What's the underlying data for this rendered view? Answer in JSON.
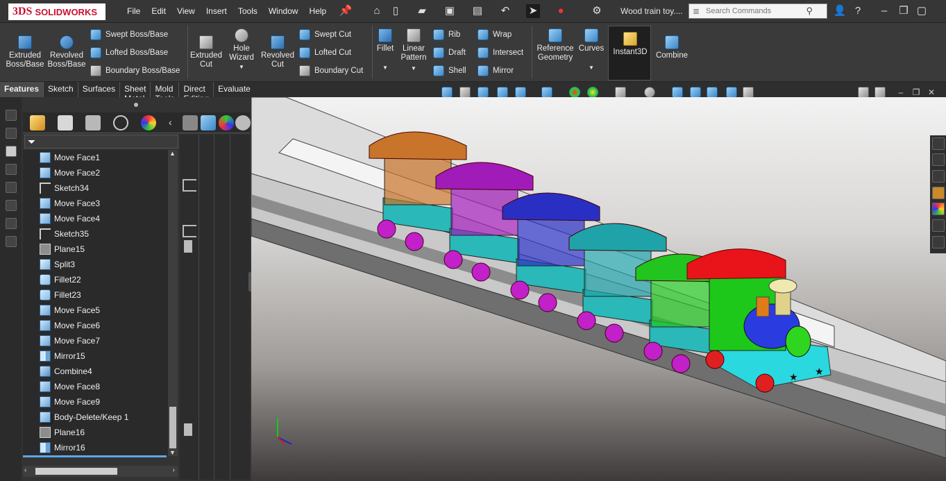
{
  "app": {
    "brand_mark": "3DS",
    "brand_name": "SOLIDWORKS",
    "document_title": "Wood train toy....",
    "menus": [
      "File",
      "Edit",
      "View",
      "Insert",
      "Tools",
      "Window",
      "Help"
    ],
    "search": {
      "placeholder": "Search Commands"
    }
  },
  "ribbon": {
    "buttons": {
      "extruded_boss": "Extruded\nBoss/Base",
      "revolved_boss": "Revolved\nBoss/Base",
      "swept_boss": "Swept Boss/Base",
      "lofted_boss": "Lofted Boss/Base",
      "boundary_boss": "Boundary Boss/Base",
      "extruded_cut": "Extruded\nCut",
      "hole_wizard": "Hole\nWizard",
      "revolved_cut": "Revolved\nCut",
      "swept_cut": "Swept Cut",
      "lofted_cut": "Lofted Cut",
      "boundary_cut": "Boundary Cut",
      "fillet": "Fillet",
      "linear_pattern": "Linear\nPattern",
      "rib": "Rib",
      "draft": "Draft",
      "shell": "Shell",
      "wrap": "Wrap",
      "intersect": "Intersect",
      "mirror": "Mirror",
      "reference_geometry": "Reference\nGeometry",
      "curves": "Curves",
      "instant3d": "Instant3D",
      "combine": "Combine"
    }
  },
  "tabs": [
    "Features",
    "Sketch",
    "Surfaces",
    "Sheet Metal",
    "Mold Tools",
    "Direct Editing",
    "Evaluate"
  ],
  "active_tab": "Features",
  "feature_tree": [
    {
      "label": "Move Face1",
      "icon": "move-face-icon"
    },
    {
      "label": "Move Face2",
      "icon": "move-face-icon"
    },
    {
      "label": "Sketch34",
      "icon": "sketch-icon"
    },
    {
      "label": "Move Face3",
      "icon": "move-face-icon"
    },
    {
      "label": "Move Face4",
      "icon": "move-face-icon"
    },
    {
      "label": "Sketch35",
      "icon": "sketch-icon"
    },
    {
      "label": "Plane15",
      "icon": "plane-icon"
    },
    {
      "label": "Split3",
      "icon": "split-icon"
    },
    {
      "label": "Fillet22",
      "icon": "fillet-icon"
    },
    {
      "label": "Fillet23",
      "icon": "fillet-icon"
    },
    {
      "label": "Move Face5",
      "icon": "move-face-icon"
    },
    {
      "label": "Move Face6",
      "icon": "move-face-icon"
    },
    {
      "label": "Move Face7",
      "icon": "move-face-icon"
    },
    {
      "label": "Mirror15",
      "icon": "mirror-icon"
    },
    {
      "label": "Combine4",
      "icon": "combine-icon"
    },
    {
      "label": "Move Face8",
      "icon": "move-face-icon"
    },
    {
      "label": "Move Face9",
      "icon": "move-face-icon"
    },
    {
      "label": "Body-Delete/Keep 1",
      "icon": "body-delete-icon"
    },
    {
      "label": "Plane16",
      "icon": "plane-icon"
    },
    {
      "label": "Mirror16",
      "icon": "mirror-icon"
    }
  ],
  "colors": {
    "accent": "#5ca6e6",
    "brand": "#c8102e",
    "train_cars": [
      "#c8742a",
      "#a01bb8",
      "#2a2fc4",
      "#1fa3a8",
      "#22c41f",
      "#e8141a"
    ]
  }
}
